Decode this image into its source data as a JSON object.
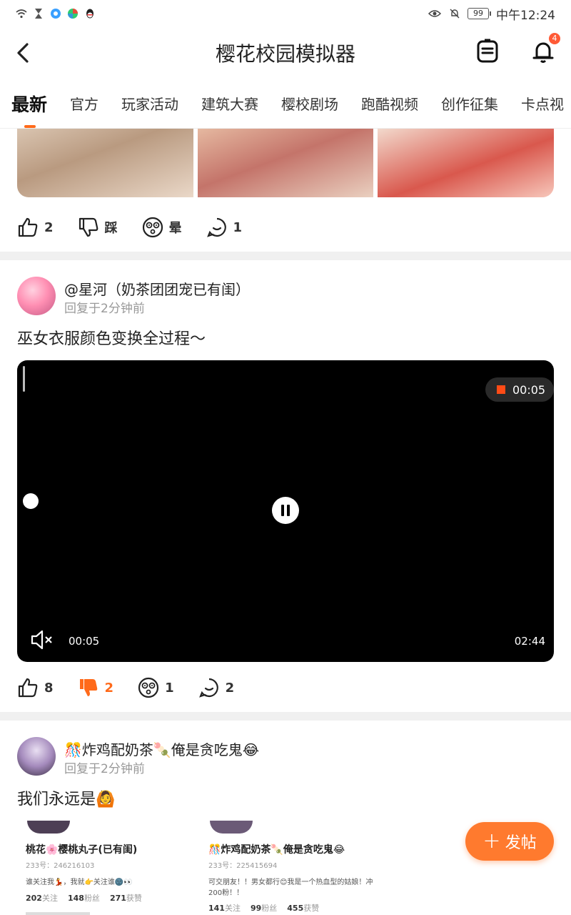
{
  "status_bar": {
    "time": "中午12:24",
    "battery": "99"
  },
  "header": {
    "title": "樱花校园模拟器",
    "notification_count": "4"
  },
  "tabs": [
    "最新",
    "官方",
    "玩家活动",
    "建筑大赛",
    "樱校剧场",
    "跑酷视频",
    "创作征集",
    "卡点视"
  ],
  "post0": {
    "reactions": {
      "like": "2",
      "dislike": "踩",
      "dizzy": "晕",
      "comment": "1"
    }
  },
  "post1": {
    "author": "@星河（奶茶团团宠已有闺）",
    "time": "回复于2分钟前",
    "text": "巫女衣服颜色变换全过程～",
    "video": {
      "rec_time": "00:05",
      "current": "00:05",
      "duration": "02:44"
    },
    "reactions": {
      "like": "8",
      "dislike": "2",
      "dizzy": "1",
      "comment": "2"
    }
  },
  "post2": {
    "author": "🎊炸鸡配奶茶🍡俺是贪吃鬼😂",
    "time": "回复于2分钟前",
    "text": "我们永远是🙆",
    "cards": [
      {
        "name": "桃花🌸樱桃丸子(已有闺)",
        "id": "233号：246216103",
        "desc": "谁关注我💃，我就👉关注谁🌚👀",
        "follow": "202",
        "follow_lbl": "关注",
        "fans": "148",
        "fans_lbl": "粉丝",
        "likes": "271",
        "likes_lbl": "获赞"
      },
      {
        "name": "🎊炸鸡配奶茶🍡俺是贪吃鬼😂",
        "id": "233号：225415694",
        "desc": "可交朋友！！男女都行😊我是一个热血型的姑娘！冲\n200粉！！",
        "follow": "141",
        "follow_lbl": "关注",
        "fans": "99",
        "fans_lbl": "粉丝",
        "likes": "455",
        "likes_lbl": "获赞"
      }
    ]
  },
  "fab": {
    "label": "发帖"
  },
  "colors": {
    "accent": "#ff6a1a",
    "divider": "#f0f0f0"
  }
}
